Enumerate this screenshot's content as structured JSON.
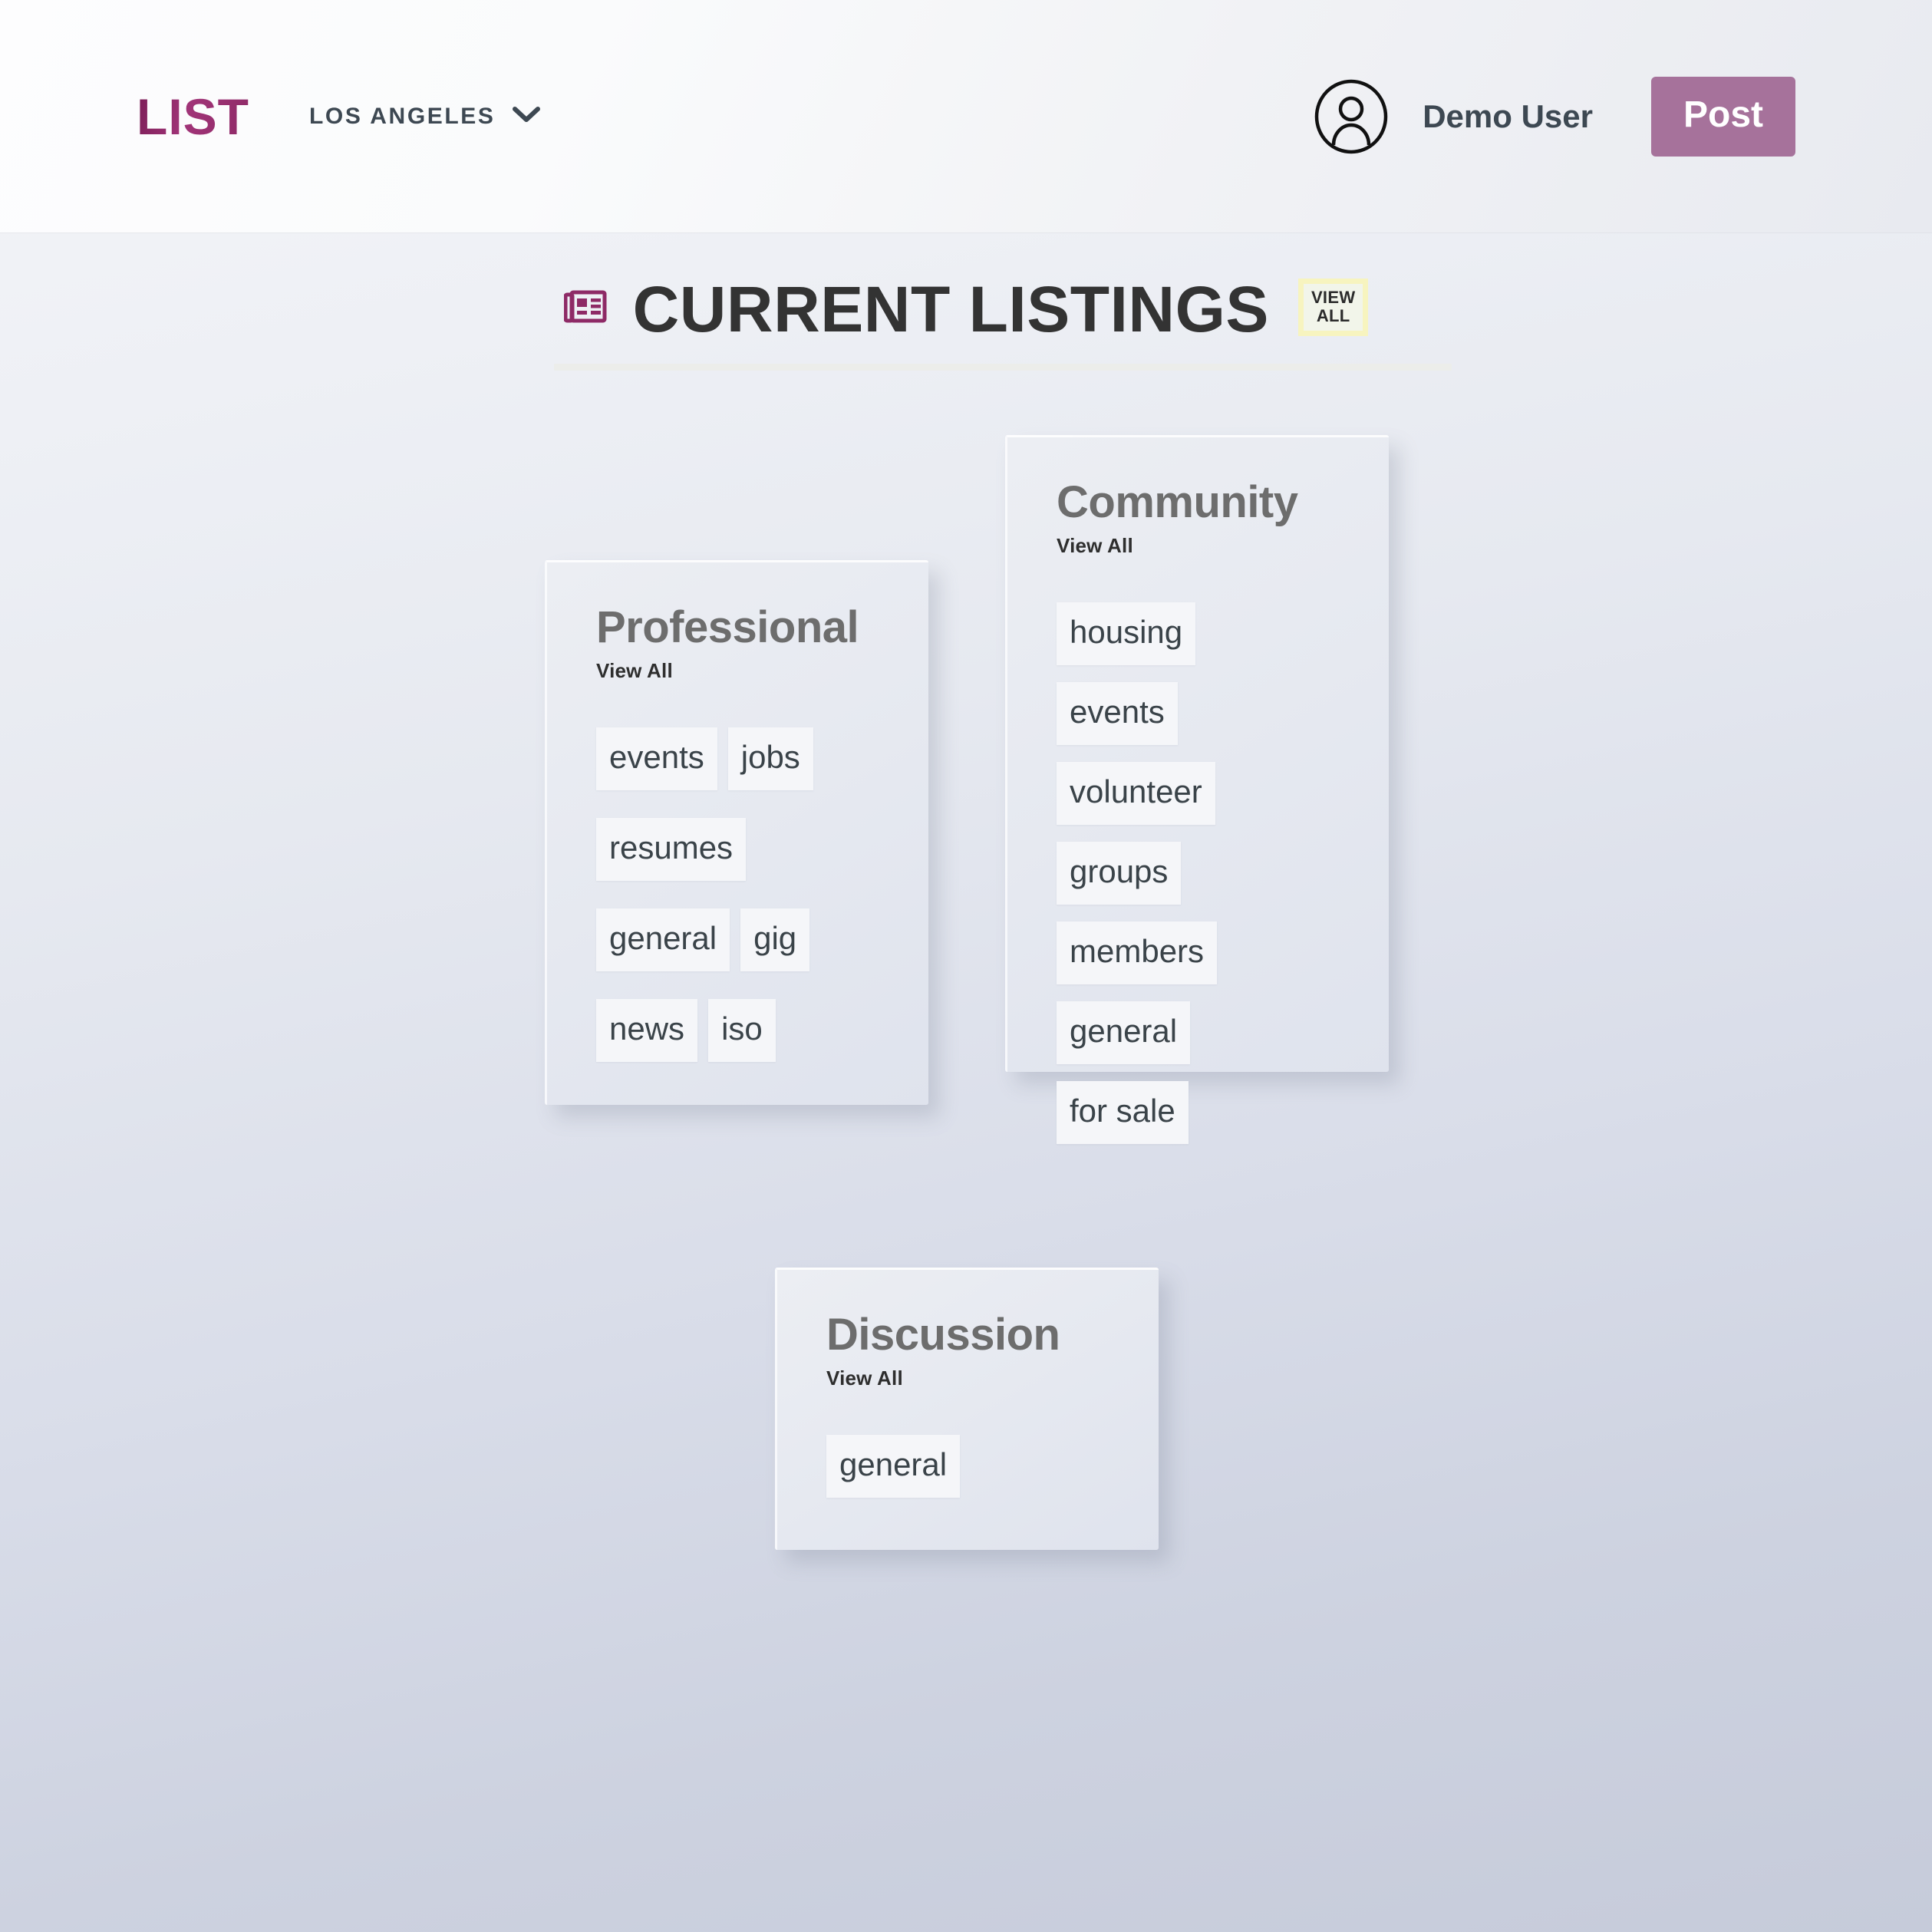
{
  "header": {
    "brand": "LIST",
    "city": "LOS ANGELES",
    "chevron_icon": "chevron-down-icon",
    "avatar_icon": "user-avatar-icon",
    "user_name": "Demo User",
    "post_label": "Post",
    "accent_color": "#a6729b",
    "brand_color": "#8e2a66"
  },
  "page": {
    "title": "CURRENT LISTINGS",
    "title_icon": "newspaper-icon",
    "view_all_badge": "VIEW\nALL",
    "view_all_badge_line1": "VIEW",
    "view_all_badge_line2": "ALL",
    "badge_color": "#f7f4bf"
  },
  "cards": [
    {
      "id": "professional",
      "title": "Professional",
      "view_all": "View All",
      "tags": [
        "events",
        "jobs",
        "resumes",
        "general",
        "gig",
        "news",
        "iso"
      ],
      "rows": [
        [
          "events",
          "jobs"
        ],
        [
          "resumes"
        ],
        [
          "general",
          "gig"
        ],
        [
          "news",
          "iso"
        ]
      ]
    },
    {
      "id": "community",
      "title": "Community",
      "view_all": "View All",
      "tags": [
        "housing",
        "events",
        "volunteer",
        "groups",
        "members",
        "general",
        "for sale"
      ]
    },
    {
      "id": "discussion",
      "title": "Discussion",
      "view_all": "View All",
      "tags": [
        "general"
      ]
    }
  ]
}
